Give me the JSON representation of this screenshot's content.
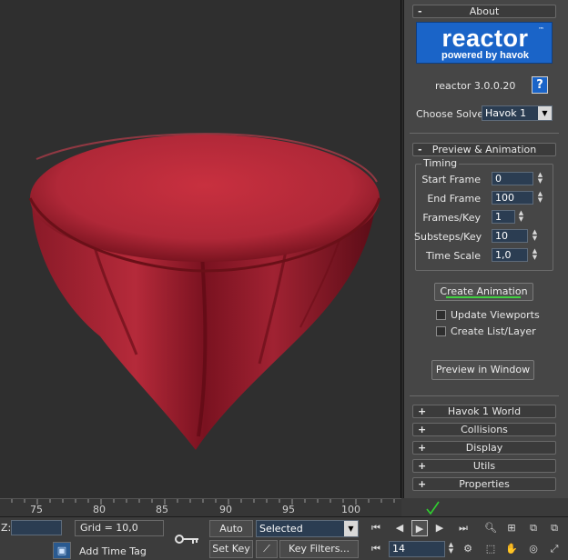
{
  "about": {
    "header": "About",
    "logo_main": "reactor",
    "logo_tm": "™",
    "logo_sub": "powered by havok",
    "version": "reactor 3.0.0.20",
    "help_label": "?",
    "solver_label": "Choose Solver:",
    "solver_value": "Havok 1"
  },
  "preview": {
    "header": "Preview & Animation",
    "timing_title": "Timing",
    "fields": [
      {
        "label": "Start Frame",
        "value": "0"
      },
      {
        "label": "End Frame",
        "value": "100"
      },
      {
        "label": "Frames/Key",
        "value": "1"
      },
      {
        "label": "Substeps/Key",
        "value": "10"
      },
      {
        "label": "Time Scale",
        "value": "1,0"
      }
    ],
    "create_animation": "Create Animation",
    "update_viewports": "Update Viewports",
    "create_list_layer": "Create List/Layer",
    "preview_in_window": "Preview in Window"
  },
  "rollouts": [
    {
      "sign": "+",
      "label": "Havok 1 World"
    },
    {
      "sign": "+",
      "label": "Collisions"
    },
    {
      "sign": "+",
      "label": "Display"
    },
    {
      "sign": "+",
      "label": "Utils"
    },
    {
      "sign": "+",
      "label": "Properties"
    }
  ],
  "collapse_sign": "-",
  "timeline": {
    "ticks": [
      "75",
      "80",
      "85",
      "90",
      "95",
      "100"
    ]
  },
  "statusbar": {
    "z_label": "Z:",
    "z_value": "",
    "grid": "Grid = 10,0",
    "auto_key": "Auto Key",
    "set_key": "Set Key",
    "selected": "Selected",
    "key_filters": "Key Filters...",
    "add_time_tag": "Add Time Tag",
    "frame": "14"
  },
  "colors": {
    "cloth": "#b8283a",
    "accent_line": "#40d040",
    "logo_blue": "#1a64c8"
  }
}
